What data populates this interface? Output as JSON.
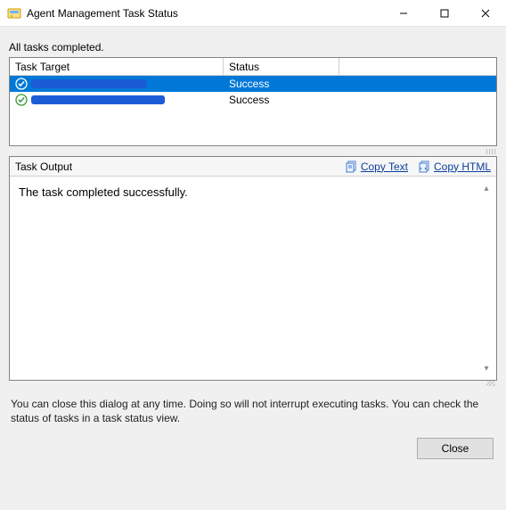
{
  "window": {
    "title": "Agent Management Task Status"
  },
  "summary": "All tasks completed.",
  "table": {
    "headers": {
      "target": "Task Target",
      "status": "Status"
    },
    "rows": [
      {
        "target_redacted": true,
        "status": "Success",
        "selected": true
      },
      {
        "target_redacted": true,
        "status": "Success",
        "selected": false
      }
    ]
  },
  "output": {
    "heading": "Task Output",
    "copy_text_label": "Copy Text",
    "copy_html_label": "Copy HTML",
    "body": "The task completed successfully."
  },
  "footer_note": "You can close this dialog at any time. Doing so will not interrupt executing tasks. You can check the status of tasks in a task status view.",
  "buttons": {
    "close": "Close"
  }
}
